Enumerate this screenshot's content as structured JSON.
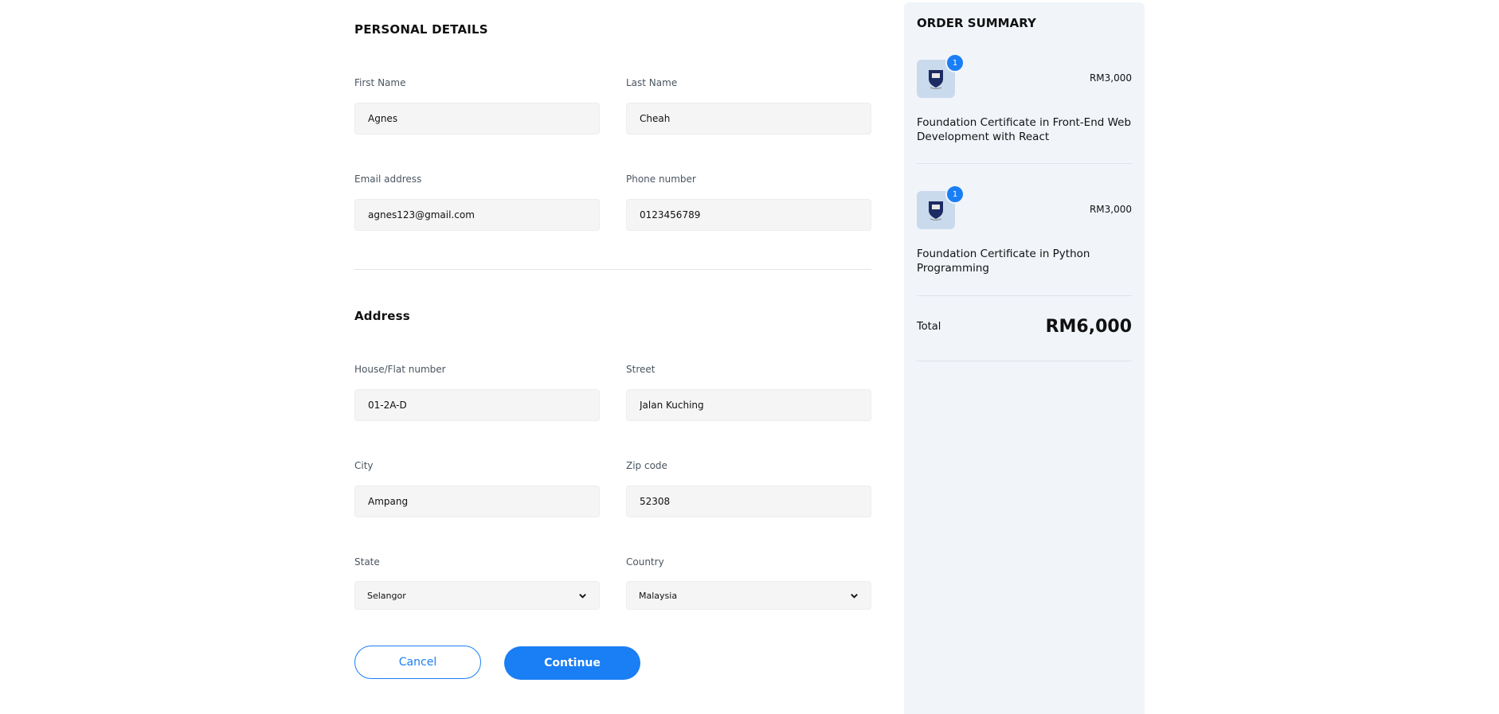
{
  "personal": {
    "title": "PERSONAL DETAILS",
    "first_name": {
      "label": "First Name",
      "value": "Agnes"
    },
    "last_name": {
      "label": "Last Name",
      "value": "Cheah"
    },
    "email": {
      "label": "Email address",
      "value": "agnes123@gmail.com"
    },
    "phone": {
      "label": "Phone number",
      "value": "0123456789"
    }
  },
  "address": {
    "title": "Address",
    "house": {
      "label": "House/Flat number",
      "value": "01-2A-D"
    },
    "street": {
      "label": "Street",
      "value": "Jalan Kuching"
    },
    "city": {
      "label": "City",
      "value": "Ampang"
    },
    "zip": {
      "label": "Zip code",
      "value": "52308"
    },
    "state": {
      "label": "State",
      "value": "Selangor"
    },
    "country": {
      "label": "Country",
      "value": "Malaysia"
    }
  },
  "actions": {
    "cancel": "Cancel",
    "continue": "Continue"
  },
  "summary": {
    "title": "ORDER SUMMARY",
    "items": [
      {
        "title": "Foundation Certificate in Front-End Web Development with React",
        "price": "RM3,000",
        "qty": "1",
        "icon": "university-crest-icon"
      },
      {
        "title": "Foundation Certificate in Python Programming",
        "price": "RM3,000",
        "qty": "1",
        "icon": "university-crest-icon"
      }
    ],
    "total_label": "Total",
    "total_value": "RM6,000"
  },
  "colors": {
    "accent": "#1a7ef5",
    "summary_bg": "#f1f5fa",
    "input_bg": "#f5f5f5"
  }
}
